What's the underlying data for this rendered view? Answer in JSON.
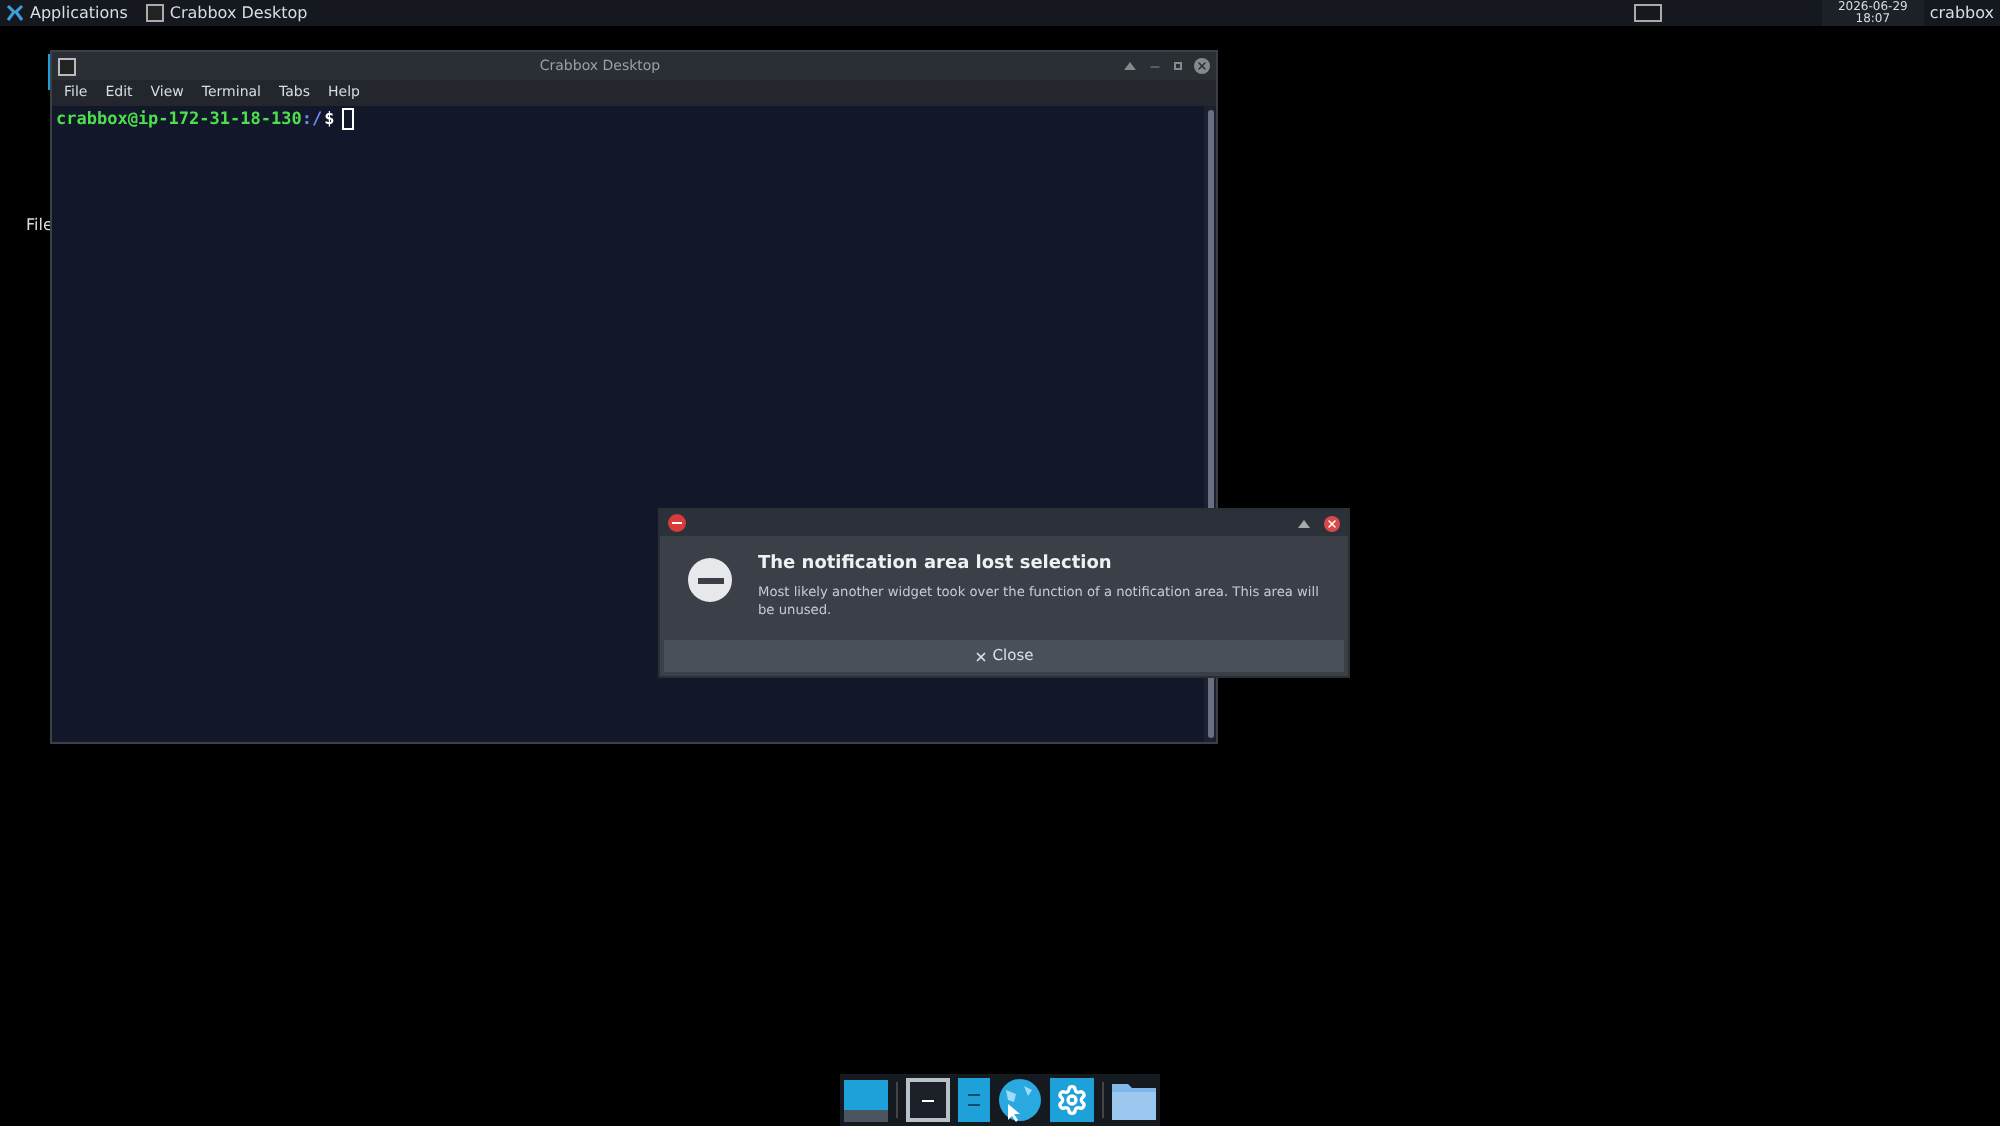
{
  "top_panel": {
    "menu": "Applications",
    "task": "Crabbox Desktop",
    "clock_date": "2026-06-29",
    "clock_time": "18:07",
    "user": "crabbox"
  },
  "desktop_icon": {
    "label": "File"
  },
  "terminal": {
    "title": "Crabbox Desktop",
    "menu": [
      "File",
      "Edit",
      "View",
      "Terminal",
      "Tabs",
      "Help"
    ],
    "prompt_user": "crabbox@ip-172-31-18-130",
    "prompt_path": ":/",
    "prompt_symbol": "$"
  },
  "notification": {
    "title": "The notification area lost selection",
    "body": "Most likely another widget took over the function of a notification area. This area will be unused.",
    "button": "Close"
  },
  "dock": [
    {
      "kind": "desktop"
    },
    {
      "kind": "terminal"
    },
    {
      "kind": "files"
    },
    {
      "kind": "browser"
    },
    {
      "kind": "settings"
    },
    {
      "kind": "folder"
    }
  ]
}
